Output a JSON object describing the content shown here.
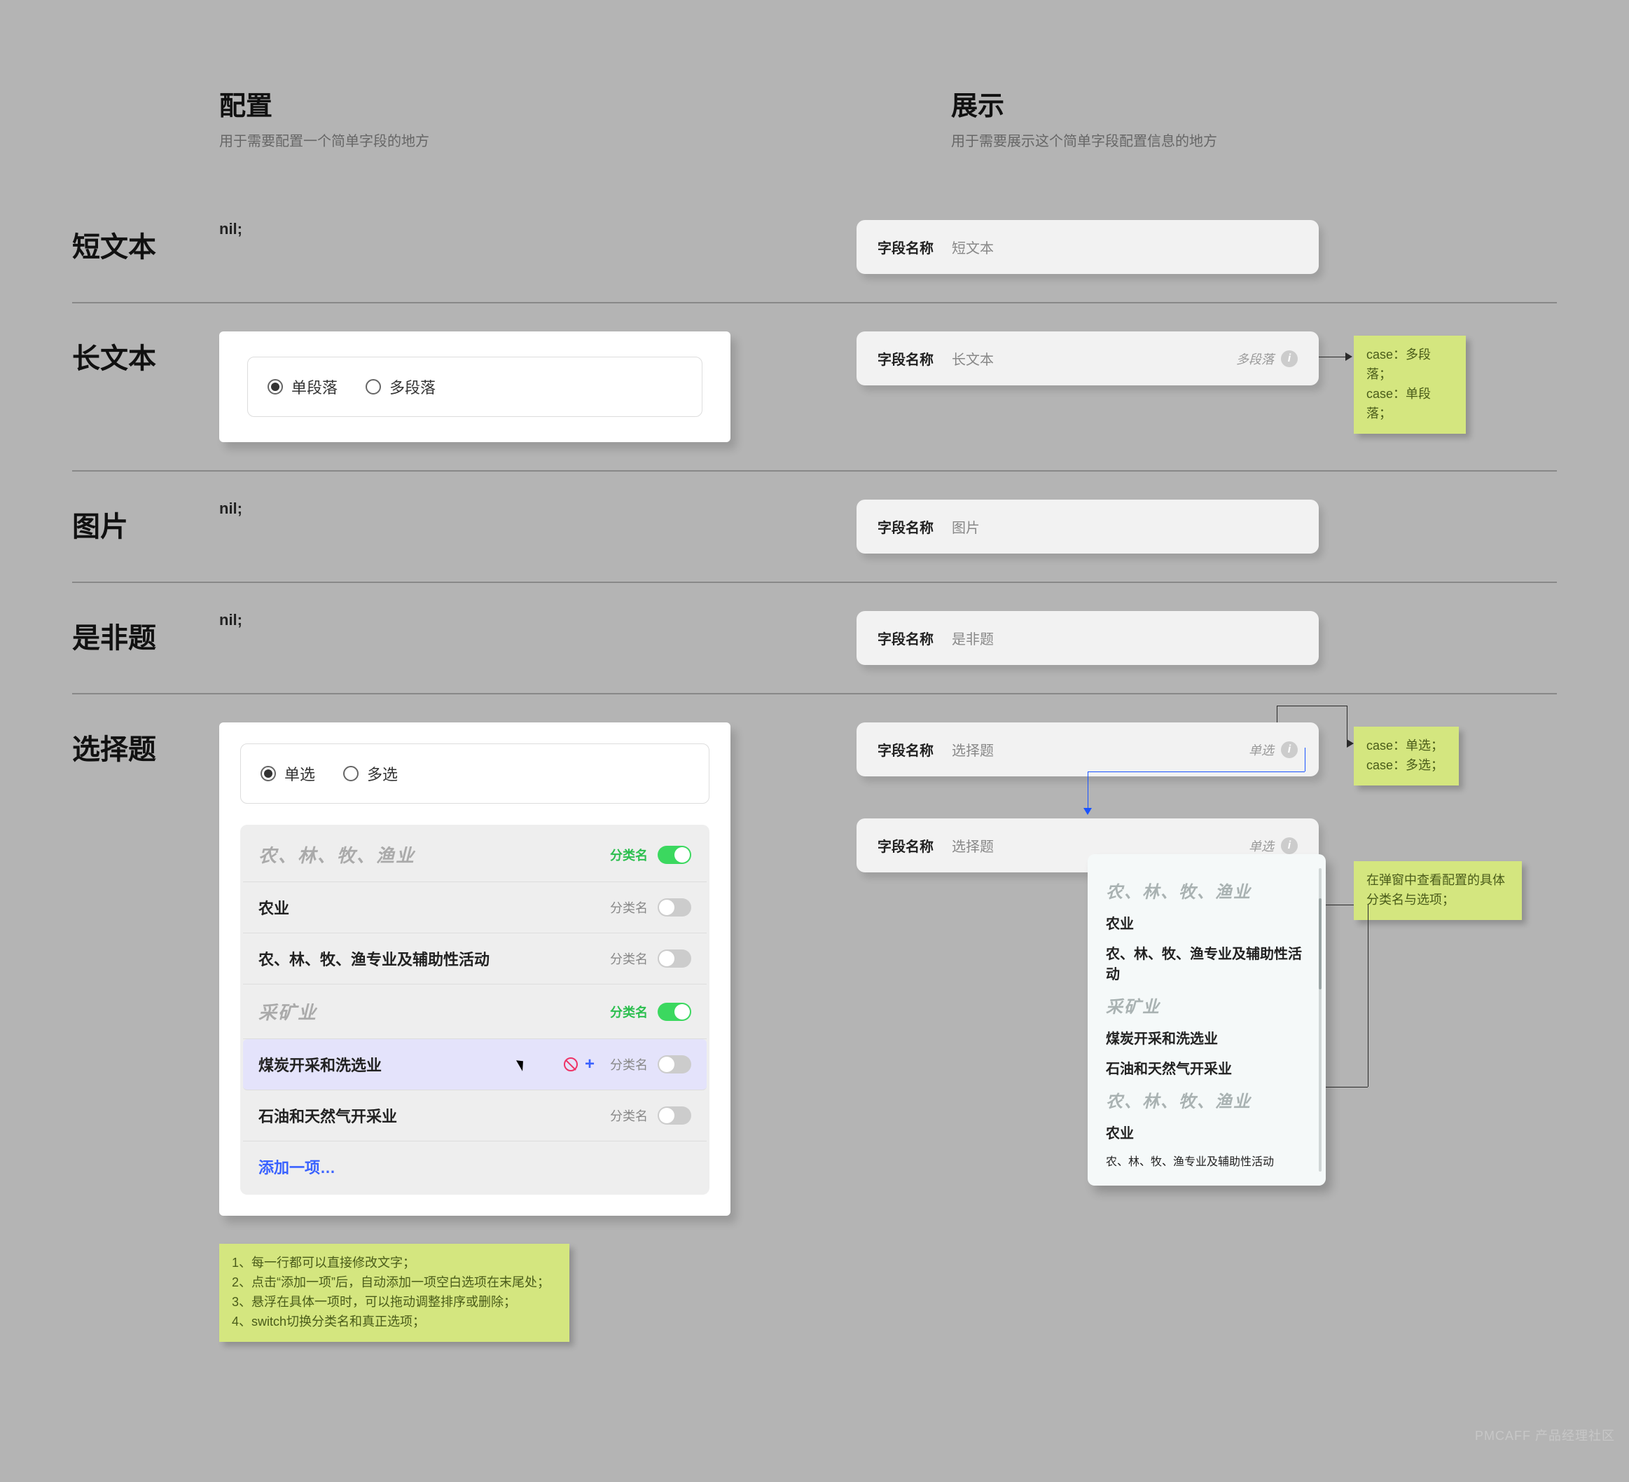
{
  "headers": {
    "config": {
      "title": "配置",
      "sub": "用于需要配置一个简单字段的地方"
    },
    "display": {
      "title": "展示",
      "sub": "用于需要展示这个简单字段配置信息的地方"
    }
  },
  "rows": {
    "short_text": {
      "title": "短文本",
      "config_nil": "nil;",
      "display": {
        "label": "字段名称",
        "value": "短文本"
      }
    },
    "long_text": {
      "title": "长文本",
      "config_radios": [
        {
          "label": "单段落",
          "checked": true
        },
        {
          "label": "多段落",
          "checked": false
        }
      ],
      "display": {
        "label": "字段名称",
        "value": "长文本",
        "tag": "多段落"
      },
      "note": "case：多段落；\ncase：单段落；"
    },
    "image": {
      "title": "图片",
      "config_nil": "nil;",
      "display": {
        "label": "字段名称",
        "value": "图片"
      }
    },
    "boolean": {
      "title": "是非题",
      "config_nil": "nil;",
      "display": {
        "label": "字段名称",
        "value": "是非题"
      }
    },
    "choice": {
      "title": "选择题",
      "config_radios": [
        {
          "label": "单选",
          "checked": true
        },
        {
          "label": "多选",
          "checked": false
        }
      ],
      "option_rows": [
        {
          "label": "农、林、牧、渔业",
          "cat": true,
          "on": true,
          "switch_label": "分类名"
        },
        {
          "label": "农业",
          "cat": false,
          "on": false,
          "switch_label": "分类名"
        },
        {
          "label": "农、林、牧、渔专业及辅助性活动",
          "cat": false,
          "on": false,
          "switch_label": "分类名"
        },
        {
          "label": "采矿业",
          "cat": true,
          "on": true,
          "switch_label": "分类名"
        },
        {
          "label": "煤炭开采和洗选业",
          "cat": false,
          "on": false,
          "switch_label": "分类名",
          "hover": true
        },
        {
          "label": "石油和天然气开采业",
          "cat": false,
          "on": false,
          "switch_label": "分类名"
        }
      ],
      "add_label": "添加一项…",
      "config_note": "1、每一行都可以直接修改文字；\n2、点击“添加一项”后，自动添加一项空白选项在末尾处；\n3、悬浮在具体一项时，可以拖动调整排序或删除；\n4、switch切换分类名和真正选项；",
      "display_pills": [
        {
          "label": "字段名称",
          "value": "选择题",
          "tag": "单选"
        },
        {
          "label": "字段名称",
          "value": "选择题",
          "tag": "单选"
        }
      ],
      "display_note_top": "case：单选；\ncase：多选；",
      "display_note_bottom": "在弹窗中查看配置的具体分类名与选项；",
      "popover": [
        {
          "type": "cat",
          "label": "农、林、牧、渔业"
        },
        {
          "type": "item",
          "label": "农业"
        },
        {
          "type": "item",
          "label": "农、林、牧、渔专业及辅助性活动"
        },
        {
          "type": "cat",
          "label": "采矿业"
        },
        {
          "type": "item",
          "label": "煤炭开采和洗选业"
        },
        {
          "type": "item",
          "label": "石油和天然气开采业"
        },
        {
          "type": "cat",
          "label": "农、林、牧、渔业"
        },
        {
          "type": "item",
          "label": "农业"
        },
        {
          "type": "item-small",
          "label": "农、林、牧、渔专业及辅助性活动"
        }
      ]
    }
  },
  "watermark": "PMCAFF 产品经理社区"
}
